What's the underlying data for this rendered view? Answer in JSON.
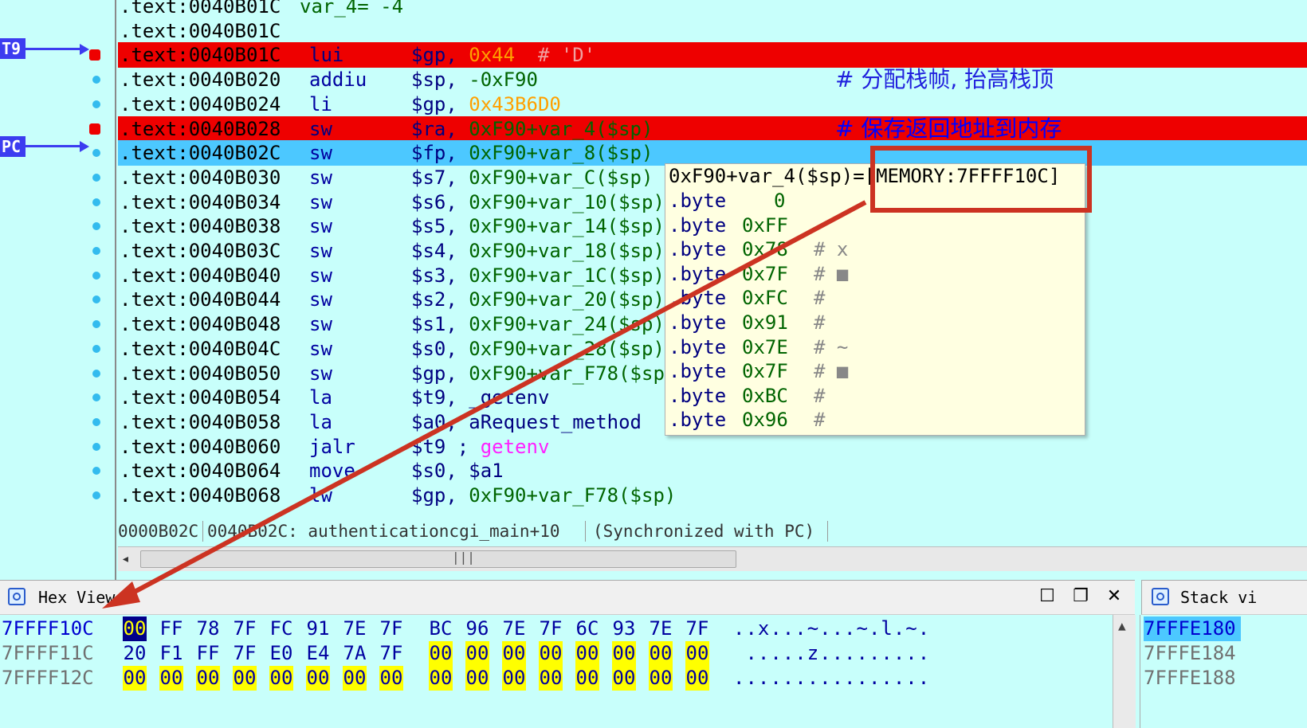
{
  "gutter": {
    "t9_label": "T9",
    "pc_label": "PC"
  },
  "disasm": {
    "rows": [
      {
        "addr": ".text:0040B01C",
        "mn": "var_4= -4",
        "op": "",
        "comment": "",
        "style": "gray"
      },
      {
        "addr": ".text:0040B01C",
        "mn": "",
        "op": "",
        "comment": "",
        "style": "normal"
      },
      {
        "addr": ".text:0040B01C",
        "mn": "lui",
        "op_reg": "$gp,",
        "op_num": "0x44",
        "op_tail": "  # 'D'",
        "comment": "",
        "style": "bp"
      },
      {
        "addr": ".text:0040B020",
        "mn": "addiu",
        "op_reg": "$sp,",
        "op_num": "-0xF90",
        "op_tail": "",
        "comment": "# 分配栈帧, 抬高栈顶",
        "style": "normal"
      },
      {
        "addr": ".text:0040B024",
        "mn": "li",
        "op_reg": "$gp,",
        "op_num": "0x43B6D0",
        "op_tail": "",
        "comment": "",
        "style": "normal"
      },
      {
        "addr": ".text:0040B028",
        "mn": "sw",
        "op_reg": "$ra,",
        "op_num": "0xF90+var_4($sp)",
        "op_tail": "",
        "comment": "# 保存返回地址到内存",
        "style": "bp"
      },
      {
        "addr": ".text:0040B02C",
        "mn": "sw",
        "op_reg": "$fp,",
        "op_num": "0xF90+var_8($sp)",
        "op_tail": "",
        "comment": "",
        "style": "pc"
      },
      {
        "addr": ".text:0040B030",
        "mn": "sw",
        "op_reg": "$s7,",
        "op_num": "0xF90+var_C($sp)",
        "op_tail": "",
        "comment": "",
        "style": "normal"
      },
      {
        "addr": ".text:0040B034",
        "mn": "sw",
        "op_reg": "$s6,",
        "op_num": "0xF90+var_10($sp)",
        "op_tail": "",
        "comment": "",
        "style": "normal"
      },
      {
        "addr": ".text:0040B038",
        "mn": "sw",
        "op_reg": "$s5,",
        "op_num": "0xF90+var_14($sp)",
        "op_tail": "",
        "comment": "",
        "style": "normal"
      },
      {
        "addr": ".text:0040B03C",
        "mn": "sw",
        "op_reg": "$s4,",
        "op_num": "0xF90+var_18($sp)",
        "op_tail": "",
        "comment": "",
        "style": "normal"
      },
      {
        "addr": ".text:0040B040",
        "mn": "sw",
        "op_reg": "$s3,",
        "op_num": "0xF90+var_1C($sp)",
        "op_tail": "",
        "comment": "",
        "style": "normal"
      },
      {
        "addr": ".text:0040B044",
        "mn": "sw",
        "op_reg": "$s2,",
        "op_num": "0xF90+var_20($sp)",
        "op_tail": "",
        "comment": "",
        "style": "normal"
      },
      {
        "addr": ".text:0040B048",
        "mn": "sw",
        "op_reg": "$s1,",
        "op_num": "0xF90+var_24($sp)",
        "op_tail": "",
        "comment": "",
        "style": "normal"
      },
      {
        "addr": ".text:0040B04C",
        "mn": "sw",
        "op_reg": "$s0,",
        "op_num": "0xF90+var_28($sp)",
        "op_tail": "",
        "comment": "",
        "style": "normal"
      },
      {
        "addr": ".text:0040B050",
        "mn": "sw",
        "op_reg": "$gp,",
        "op_num": "0xF90+var_F78($sp",
        "op_tail": "",
        "comment": "",
        "style": "normal"
      },
      {
        "addr": ".text:0040B054",
        "mn": "la",
        "op_reg": "$t9,",
        "op_num": "_getenv",
        "op_tail": "",
        "comment": "",
        "style": "normal"
      },
      {
        "addr": ".text:0040B058",
        "mn": "la",
        "op_reg": "$a0,",
        "op_num": "aRequest_method",
        "op_tail": "",
        "comment": "",
        "style": "normal"
      },
      {
        "addr": ".text:0040B060",
        "mn": "jalr",
        "op_reg": "$t9 ;",
        "op_num": "getenv",
        "op_tail": "",
        "comment": "",
        "style": "normal"
      },
      {
        "addr": ".text:0040B064",
        "mn": "move",
        "op_reg": "$s0,",
        "op_num": "$a1",
        "op_tail": "",
        "comment": "",
        "style": "normal"
      },
      {
        "addr": ".text:0040B068",
        "mn": "lw",
        "op_reg": "$gp,",
        "op_num": "0xF90+var_F78($sp)",
        "op_tail": "",
        "comment": "",
        "style": "normal"
      }
    ]
  },
  "status": {
    "offset": "0000B02C",
    "location": "0040B02C: authenticationcgi_main+10",
    "sync": "(Synchronized with PC)"
  },
  "popup": {
    "title": "0xF90+var_4($sp)=[MEMORY:7FFFF10C]",
    "rows": [
      {
        "kw": ".byte",
        "val": "0",
        "cm": ""
      },
      {
        "kw": ".byte",
        "val": "0xFF",
        "cm": ""
      },
      {
        "kw": ".byte",
        "val": "0x78",
        "cm": "# x"
      },
      {
        "kw": ".byte",
        "val": "0x7F",
        "cm": "# ■"
      },
      {
        "kw": ".byte",
        "val": "0xFC",
        "cm": "#"
      },
      {
        "kw": ".byte",
        "val": "0x91",
        "cm": "#"
      },
      {
        "kw": ".byte",
        "val": "0x7E",
        "cm": "# ~"
      },
      {
        "kw": ".byte",
        "val": "0x7F",
        "cm": "# ■"
      },
      {
        "kw": ".byte",
        "val": "0xBC",
        "cm": "#"
      },
      {
        "kw": ".byte",
        "val": "0x96",
        "cm": "#"
      }
    ]
  },
  "hex_view": {
    "title": "Hex View-1",
    "rows": [
      {
        "addr": "7FFFF10C",
        "bytes": [
          "00",
          "FF",
          "78",
          "7F",
          "FC",
          "91",
          "7E",
          "7F",
          "BC",
          "96",
          "7E",
          "7F",
          "6C",
          "93",
          "7E",
          "7F"
        ],
        "ascii": "..x...~...~.l.~."
      },
      {
        "addr": "7FFFF11C",
        "bytes": [
          "20",
          "F1",
          "FF",
          "7F",
          "E0",
          "E4",
          "7A",
          "7F",
          "00",
          "00",
          "00",
          "00",
          "00",
          "00",
          "00",
          "00"
        ],
        "ascii": " .....z........."
      },
      {
        "addr": "7FFFF12C",
        "bytes": [
          "00",
          "00",
          "00",
          "00",
          "00",
          "00",
          "00",
          "00",
          "00",
          "00",
          "00",
          "00",
          "00",
          "00",
          "00",
          "00"
        ],
        "ascii": "................"
      }
    ]
  },
  "stack_view": {
    "title": "Stack vi",
    "rows": [
      "7FFFE180",
      "7FFFE184",
      "7FFFE188"
    ]
  },
  "colors": {
    "background": "#c8fffb",
    "breakpoint": "#ee0000",
    "pc_highlight": "#4cc8ff",
    "arrow_tag": "#3c3cf0",
    "callout": "#cc3322"
  }
}
